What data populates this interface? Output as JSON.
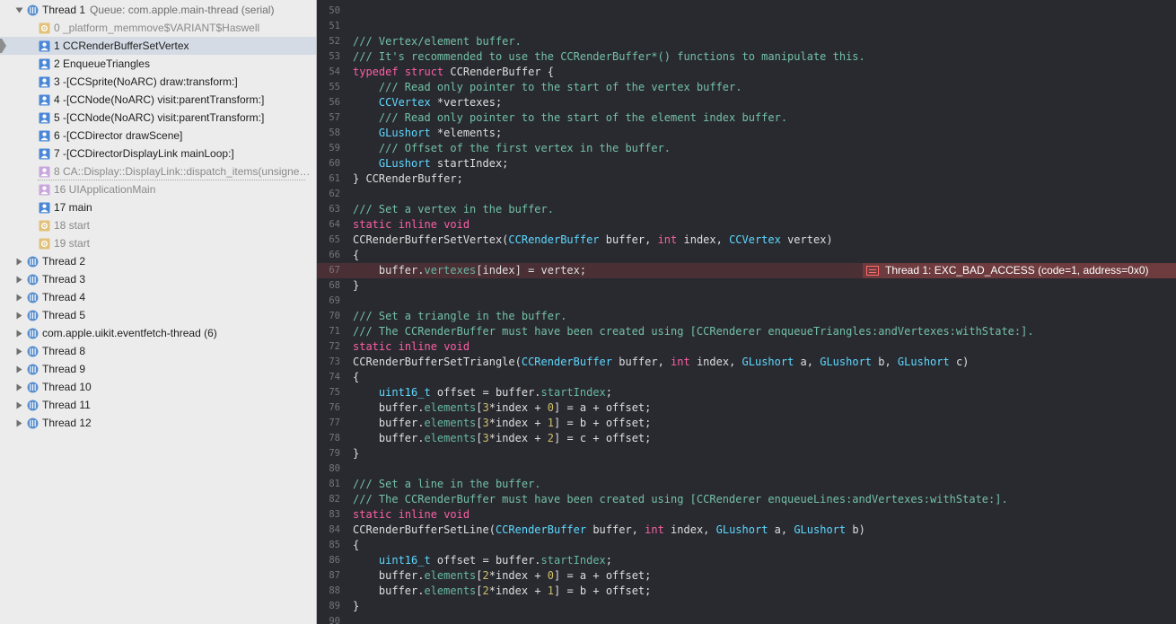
{
  "colors": {
    "navigator_bg": "#ececec",
    "selected_row": "#d4dbe5",
    "editor_bg": "#292a30",
    "error_line": "#4a3034",
    "error_badge": "#6e3b3e",
    "comment": "#73c0a6",
    "keyword": "#fc5fa3",
    "type": "#5dd8ff"
  },
  "navigator": {
    "rows": [
      {
        "label": "Thread 1",
        "sub": "Queue: com.apple.main-thread (serial)",
        "icon": "thread-icon",
        "disclosure": "open",
        "indent": 0
      },
      {
        "label": "0 _platform_memmove$VARIANT$Haswell",
        "icon": "library-frame-icon",
        "indent": 1,
        "dim": true
      },
      {
        "label": "1 CCRenderBufferSetVertex",
        "icon": "user-frame-icon",
        "indent": 1,
        "selected": true
      },
      {
        "label": "2 EnqueueTriangles",
        "icon": "user-frame-icon",
        "indent": 1
      },
      {
        "label": "3 -[CCSprite(NoARC) draw:transform:]",
        "icon": "user-frame-icon",
        "indent": 1
      },
      {
        "label": "4 -[CCNode(NoARC) visit:parentTransform:]",
        "icon": "user-frame-icon",
        "indent": 1
      },
      {
        "label": "5 -[CCNode(NoARC) visit:parentTransform:]",
        "icon": "user-frame-icon",
        "indent": 1
      },
      {
        "label": "6 -[CCDirector drawScene]",
        "icon": "user-frame-icon",
        "indent": 1
      },
      {
        "label": "7 -[CCDirectorDisplayLink mainLoop:]",
        "icon": "user-frame-icon",
        "indent": 1
      },
      {
        "label": "8 CA::Display::DisplayLink::dispatch_items(unsigne…",
        "icon": "system-frame-icon",
        "indent": 1,
        "dim": true
      },
      {
        "label": "16 UIApplicationMain",
        "icon": "system-frame-icon",
        "indent": 1,
        "dim": true
      },
      {
        "label": "17 main",
        "icon": "user-frame-icon",
        "indent": 1
      },
      {
        "label": "18 start",
        "icon": "library-frame-icon",
        "indent": 1,
        "dim": true
      },
      {
        "label": "19 start",
        "icon": "library-frame-icon",
        "indent": 1,
        "dim": true
      },
      {
        "label": "Thread 2",
        "icon": "thread-icon",
        "disclosure": "closed",
        "indent": 0
      },
      {
        "label": "Thread 3",
        "icon": "thread-icon",
        "disclosure": "closed",
        "indent": 0
      },
      {
        "label": "Thread 4",
        "icon": "thread-icon",
        "disclosure": "closed",
        "indent": 0
      },
      {
        "label": "Thread 5",
        "icon": "thread-icon",
        "disclosure": "closed",
        "indent": 0
      },
      {
        "label": "com.apple.uikit.eventfetch-thread (6)",
        "icon": "thread-icon",
        "disclosure": "closed",
        "indent": 0
      },
      {
        "label": "Thread 8",
        "icon": "thread-icon",
        "disclosure": "closed",
        "indent": 0
      },
      {
        "label": "Thread 9",
        "icon": "thread-icon",
        "disclosure": "closed",
        "indent": 0
      },
      {
        "label": "Thread 10",
        "icon": "thread-icon",
        "disclosure": "closed",
        "indent": 0
      },
      {
        "label": "Thread 11",
        "icon": "thread-icon",
        "disclosure": "closed",
        "indent": 0
      },
      {
        "label": "Thread 12",
        "icon": "thread-icon",
        "disclosure": "closed",
        "indent": 0
      }
    ]
  },
  "editor": {
    "error_line_number": 67,
    "error_message": "Thread 1: EXC_BAD_ACCESS (code=1, address=0x0)",
    "lines": [
      {
        "n": 50,
        "t": []
      },
      {
        "n": 51,
        "t": []
      },
      {
        "n": 52,
        "t": [
          [
            "c",
            "/// Vertex/element buffer."
          ]
        ]
      },
      {
        "n": 53,
        "t": [
          [
            "c",
            "/// It's recommended to use the CCRenderBuffer*() functions to manipulate this."
          ]
        ]
      },
      {
        "n": 54,
        "t": [
          [
            "k",
            "typedef"
          ],
          [
            "p",
            " "
          ],
          [
            "k",
            "struct"
          ],
          [
            "p",
            " CCRenderBuffer {"
          ]
        ]
      },
      {
        "n": 55,
        "t": [
          [
            "p",
            "    "
          ],
          [
            "c",
            "/// Read only pointer to the start of the vertex buffer."
          ]
        ]
      },
      {
        "n": 56,
        "t": [
          [
            "p",
            "    "
          ],
          [
            "ty",
            "CCVertex"
          ],
          [
            "p",
            " *vertexes;"
          ]
        ]
      },
      {
        "n": 57,
        "t": [
          [
            "p",
            "    "
          ],
          [
            "c",
            "/// Read only pointer to the start of the element index buffer."
          ]
        ]
      },
      {
        "n": 58,
        "t": [
          [
            "p",
            "    "
          ],
          [
            "ty",
            "GLushort"
          ],
          [
            "p",
            " *elements;"
          ]
        ]
      },
      {
        "n": 59,
        "t": [
          [
            "p",
            "    "
          ],
          [
            "c",
            "/// Offset of the first vertex in the buffer."
          ]
        ]
      },
      {
        "n": 60,
        "t": [
          [
            "p",
            "    "
          ],
          [
            "ty",
            "GLushort"
          ],
          [
            "p",
            " startIndex;"
          ]
        ]
      },
      {
        "n": 61,
        "t": [
          [
            "p",
            "} CCRenderBuffer;"
          ]
        ]
      },
      {
        "n": 62,
        "t": []
      },
      {
        "n": 63,
        "t": [
          [
            "c",
            "/// Set a vertex in the buffer."
          ]
        ]
      },
      {
        "n": 64,
        "t": [
          [
            "k",
            "static"
          ],
          [
            "p",
            " "
          ],
          [
            "k",
            "inline"
          ],
          [
            "p",
            " "
          ],
          [
            "k",
            "void"
          ]
        ]
      },
      {
        "n": 65,
        "t": [
          [
            "p",
            "CCRenderBufferSetVertex("
          ],
          [
            "ty",
            "CCRenderBuffer"
          ],
          [
            "p",
            " buffer, "
          ],
          [
            "k",
            "int"
          ],
          [
            "p",
            " index, "
          ],
          [
            "ty",
            "CCVertex"
          ],
          [
            "p",
            " vertex)"
          ]
        ]
      },
      {
        "n": 66,
        "t": [
          [
            "p",
            "{"
          ]
        ]
      },
      {
        "n": 67,
        "t": [
          [
            "p",
            "    buffer."
          ],
          [
            "tl",
            "vertexes"
          ],
          [
            "p",
            "[index] = vertex;"
          ]
        ]
      },
      {
        "n": 68,
        "t": [
          [
            "p",
            "}"
          ]
        ]
      },
      {
        "n": 69,
        "t": []
      },
      {
        "n": 70,
        "t": [
          [
            "c",
            "/// Set a triangle in the buffer."
          ]
        ]
      },
      {
        "n": 71,
        "t": [
          [
            "c",
            "/// The CCRenderBuffer must have been created using [CCRenderer enqueueTriangles:andVertexes:withState:]."
          ]
        ]
      },
      {
        "n": 72,
        "t": [
          [
            "k",
            "static"
          ],
          [
            "p",
            " "
          ],
          [
            "k",
            "inline"
          ],
          [
            "p",
            " "
          ],
          [
            "k",
            "void"
          ]
        ]
      },
      {
        "n": 73,
        "t": [
          [
            "p",
            "CCRenderBufferSetTriangle("
          ],
          [
            "ty",
            "CCRenderBuffer"
          ],
          [
            "p",
            " buffer, "
          ],
          [
            "k",
            "int"
          ],
          [
            "p",
            " index, "
          ],
          [
            "ty",
            "GLushort"
          ],
          [
            "p",
            " a, "
          ],
          [
            "ty",
            "GLushort"
          ],
          [
            "p",
            " b, "
          ],
          [
            "ty",
            "GLushort"
          ],
          [
            "p",
            " c)"
          ]
        ]
      },
      {
        "n": 74,
        "t": [
          [
            "p",
            "{"
          ]
        ]
      },
      {
        "n": 75,
        "t": [
          [
            "p",
            "    "
          ],
          [
            "ty",
            "uint16_t"
          ],
          [
            "p",
            " offset = buffer."
          ],
          [
            "tl",
            "startIndex"
          ],
          [
            "p",
            ";"
          ]
        ]
      },
      {
        "n": 76,
        "t": [
          [
            "p",
            "    buffer."
          ],
          [
            "tl",
            "elements"
          ],
          [
            "p",
            "["
          ],
          [
            "nu",
            "3"
          ],
          [
            "p",
            "*index + "
          ],
          [
            "nu",
            "0"
          ],
          [
            "p",
            "] = a + offset;"
          ]
        ]
      },
      {
        "n": 77,
        "t": [
          [
            "p",
            "    buffer."
          ],
          [
            "tl",
            "elements"
          ],
          [
            "p",
            "["
          ],
          [
            "nu",
            "3"
          ],
          [
            "p",
            "*index + "
          ],
          [
            "nu",
            "1"
          ],
          [
            "p",
            "] = b + offset;"
          ]
        ]
      },
      {
        "n": 78,
        "t": [
          [
            "p",
            "    buffer."
          ],
          [
            "tl",
            "elements"
          ],
          [
            "p",
            "["
          ],
          [
            "nu",
            "3"
          ],
          [
            "p",
            "*index + "
          ],
          [
            "nu",
            "2"
          ],
          [
            "p",
            "] = c + offset;"
          ]
        ]
      },
      {
        "n": 79,
        "t": [
          [
            "p",
            "}"
          ]
        ]
      },
      {
        "n": 80,
        "t": []
      },
      {
        "n": 81,
        "t": [
          [
            "c",
            "/// Set a line in the buffer."
          ]
        ]
      },
      {
        "n": 82,
        "t": [
          [
            "c",
            "/// The CCRenderBuffer must have been created using [CCRenderer enqueueLines:andVertexes:withState:]."
          ]
        ]
      },
      {
        "n": 83,
        "t": [
          [
            "k",
            "static"
          ],
          [
            "p",
            " "
          ],
          [
            "k",
            "inline"
          ],
          [
            "p",
            " "
          ],
          [
            "k",
            "void"
          ]
        ]
      },
      {
        "n": 84,
        "t": [
          [
            "p",
            "CCRenderBufferSetLine("
          ],
          [
            "ty",
            "CCRenderBuffer"
          ],
          [
            "p",
            " buffer, "
          ],
          [
            "k",
            "int"
          ],
          [
            "p",
            " index, "
          ],
          [
            "ty",
            "GLushort"
          ],
          [
            "p",
            " a, "
          ],
          [
            "ty",
            "GLushort"
          ],
          [
            "p",
            " b)"
          ]
        ]
      },
      {
        "n": 85,
        "t": [
          [
            "p",
            "{"
          ]
        ]
      },
      {
        "n": 86,
        "t": [
          [
            "p",
            "    "
          ],
          [
            "ty",
            "uint16_t"
          ],
          [
            "p",
            " offset = buffer."
          ],
          [
            "tl",
            "startIndex"
          ],
          [
            "p",
            ";"
          ]
        ]
      },
      {
        "n": 87,
        "t": [
          [
            "p",
            "    buffer."
          ],
          [
            "tl",
            "elements"
          ],
          [
            "p",
            "["
          ],
          [
            "nu",
            "2"
          ],
          [
            "p",
            "*index + "
          ],
          [
            "nu",
            "0"
          ],
          [
            "p",
            "] = a + offset;"
          ]
        ]
      },
      {
        "n": 88,
        "t": [
          [
            "p",
            "    buffer."
          ],
          [
            "tl",
            "elements"
          ],
          [
            "p",
            "["
          ],
          [
            "nu",
            "2"
          ],
          [
            "p",
            "*index + "
          ],
          [
            "nu",
            "1"
          ],
          [
            "p",
            "] = b + offset;"
          ]
        ]
      },
      {
        "n": 89,
        "t": [
          [
            "p",
            "}"
          ]
        ]
      },
      {
        "n": 90,
        "t": []
      }
    ]
  }
}
